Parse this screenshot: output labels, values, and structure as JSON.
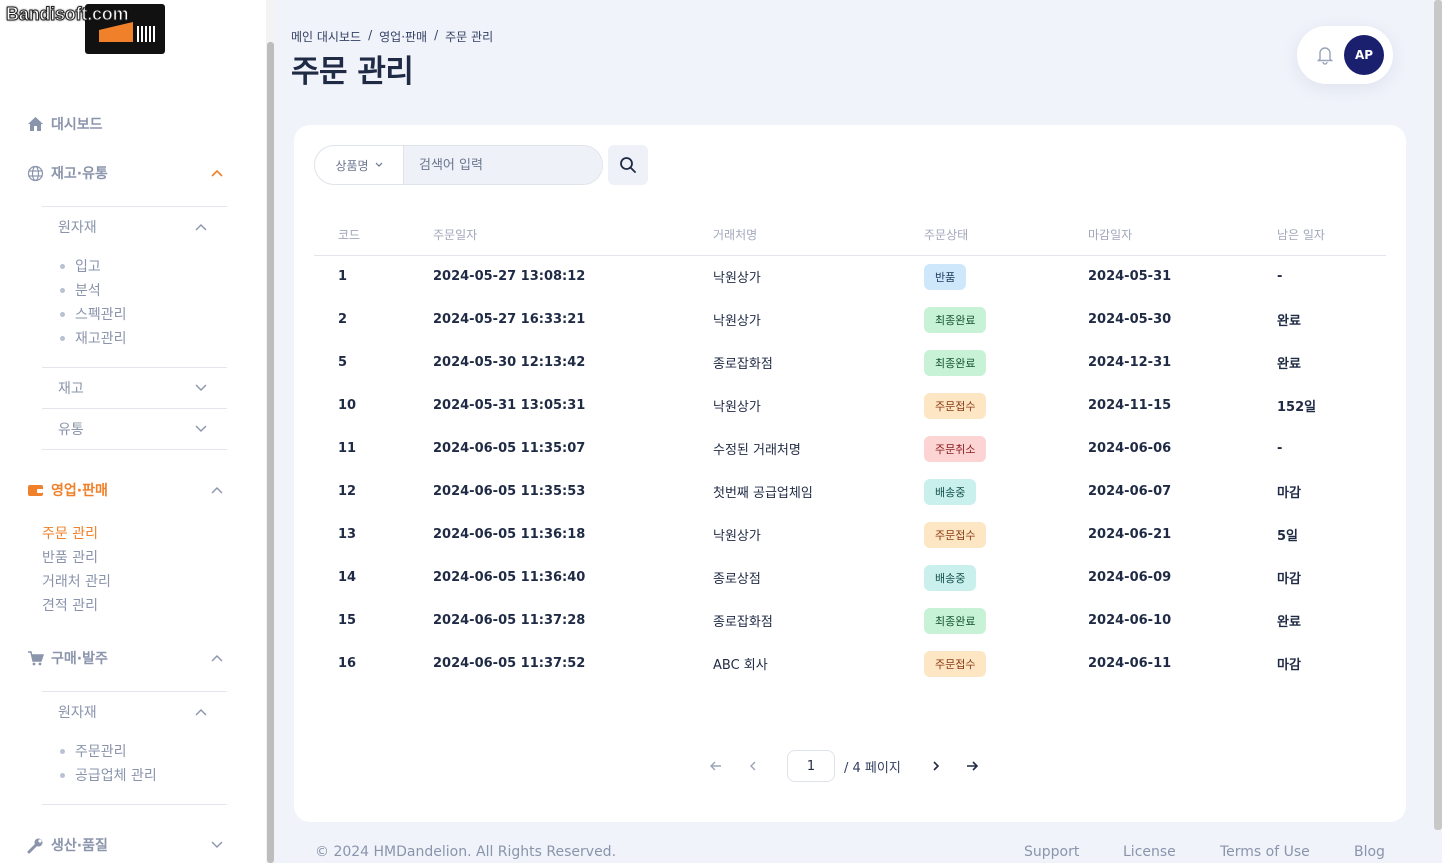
{
  "watermark": "Bandisoft.com",
  "sidebar": {
    "dashboard": "대시보드",
    "inventory": "재고·유통",
    "inventory_raw": "원자재",
    "inventory_raw_items": [
      "입고",
      "분석",
      "스펙관리",
      "재고관리"
    ],
    "inventory_stock": "재고",
    "inventory_dist": "유통",
    "sales": "영업·판매",
    "sales_items": [
      "주문 관리",
      "반품 관리",
      "거래처 관리",
      "견적 관리"
    ],
    "purchase": "구매·발주",
    "purchase_raw": "원자재",
    "purchase_raw_items": [
      "주문관리",
      "공급업체 관리"
    ],
    "production": "생산·품질"
  },
  "breadcrumb": [
    "메인 대시보드",
    "영업·판매",
    "주문 관리"
  ],
  "page_title": "주문 관리",
  "user": {
    "initials": "AP"
  },
  "search": {
    "select_label": "상품명",
    "placeholder": "검색어 입력"
  },
  "table": {
    "headers": [
      "코드",
      "주문일자",
      "거래처명",
      "주문상태",
      "마감일자",
      "남은 일자"
    ],
    "rows": [
      {
        "code": "1",
        "date": "2024-05-27 13:08:12",
        "client": "낙원상가",
        "status": "반품",
        "status_kind": "return",
        "due": "2024-05-31",
        "remain": "-",
        "remain_kind": "norm"
      },
      {
        "code": "2",
        "date": "2024-05-27 16:33:21",
        "client": "낙원상가",
        "status": "최종완료",
        "status_kind": "done",
        "due": "2024-05-30",
        "remain": "완료",
        "remain_kind": "done"
      },
      {
        "code": "5",
        "date": "2024-05-30 12:13:42",
        "client": "종로잡화점",
        "status": "최종완료",
        "status_kind": "done",
        "due": "2024-12-31",
        "remain": "완료",
        "remain_kind": "done"
      },
      {
        "code": "10",
        "date": "2024-05-31 13:05:31",
        "client": "낙원상가",
        "status": "주문접수",
        "status_kind": "received",
        "due": "2024-11-15",
        "remain": "152일",
        "remain_kind": "norm"
      },
      {
        "code": "11",
        "date": "2024-06-05 11:35:07",
        "client": "수정된 거래처명",
        "status": "주문취소",
        "status_kind": "cancel",
        "due": "2024-06-06",
        "remain": "-",
        "remain_kind": "norm"
      },
      {
        "code": "12",
        "date": "2024-06-05 11:35:53",
        "client": "첫번째 공급업체임",
        "status": "배송중",
        "status_kind": "shipping",
        "due": "2024-06-07",
        "remain": "마감",
        "remain_kind": "norm"
      },
      {
        "code": "13",
        "date": "2024-06-05 11:36:18",
        "client": "낙원상가",
        "status": "주문접수",
        "status_kind": "received",
        "due": "2024-06-21",
        "remain": "5일",
        "remain_kind": "norm"
      },
      {
        "code": "14",
        "date": "2024-06-05 11:36:40",
        "client": "종로상점",
        "status": "배송중",
        "status_kind": "shipping",
        "due": "2024-06-09",
        "remain": "마감",
        "remain_kind": "norm"
      },
      {
        "code": "15",
        "date": "2024-06-05 11:37:28",
        "client": "종로잡화점",
        "status": "최종완료",
        "status_kind": "done",
        "due": "2024-06-10",
        "remain": "완료",
        "remain_kind": "done"
      },
      {
        "code": "16",
        "date": "2024-06-05 11:37:52",
        "client": "ABC 회사",
        "status": "주문접수",
        "status_kind": "received",
        "due": "2024-06-11",
        "remain": "마감",
        "remain_kind": "norm"
      }
    ]
  },
  "status_colors": {
    "return": {
      "bg": "#cfe7fb",
      "fg": "#1e3a5f"
    },
    "done": {
      "bg": "#c8f2d6",
      "fg": "#14532d"
    },
    "received": {
      "bg": "#fde6c4",
      "fg": "#8a3b12"
    },
    "cancel": {
      "bg": "#fdd4d4",
      "fg": "#8a1c1c"
    },
    "shipping": {
      "bg": "#c9f0ec",
      "fg": "#134e4a"
    }
  },
  "pagination": {
    "current": "1",
    "total_label": "/ 4 페이지"
  },
  "footer": {
    "copyright": "© 2024 HMDandelion. All Rights Reserved.",
    "links": [
      "Support",
      "License",
      "Terms of Use",
      "Blog"
    ]
  },
  "accent_color": "#f0802a"
}
